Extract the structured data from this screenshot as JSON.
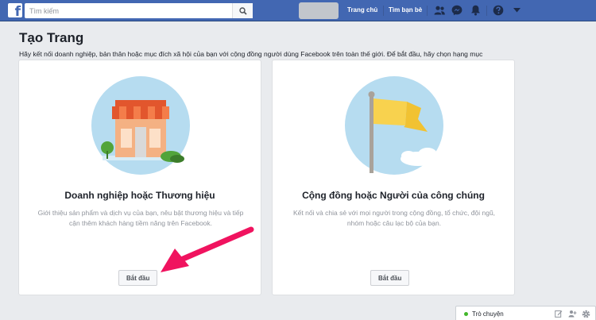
{
  "topbar": {
    "logo_letter": "f",
    "search_placeholder": "Tìm kiếm",
    "nav": {
      "home": "Trang chủ",
      "find_friends": "Tìm bạn bè"
    }
  },
  "page": {
    "title": "Tạo Trang",
    "description": "Hãy kết nối doanh nghiệp, bản thân hoặc mục đích xã hội của bạn với cộng đồng người dùng Facebook trên toàn thế giới. Để bắt đầu, hãy chọn hạng mục"
  },
  "cards": [
    {
      "title": "Doanh nghiệp hoặc Thương hiệu",
      "description": "Giới thiệu sản phẩm và dịch vụ của bạn, nêu bật thương hiệu và tiếp cận thêm khách hàng tiềm năng trên Facebook.",
      "button": "Bắt đầu",
      "illustration": "storefront-icon"
    },
    {
      "title": "Cộng đồng hoặc Người của công chúng",
      "description": "Kết nối và chia sẻ với mọi người trong cộng đồng, tổ chức, đội ngũ, nhóm hoặc câu lạc bộ của bạn.",
      "button": "Bắt đầu",
      "illustration": "flag-icon"
    }
  ],
  "chat": {
    "label": "Trò chuyện",
    "status": "online"
  },
  "colors": {
    "brand": "#4267b2",
    "background": "#e9ebee",
    "annotation_arrow": "#f0135f",
    "online": "#42b72a"
  }
}
